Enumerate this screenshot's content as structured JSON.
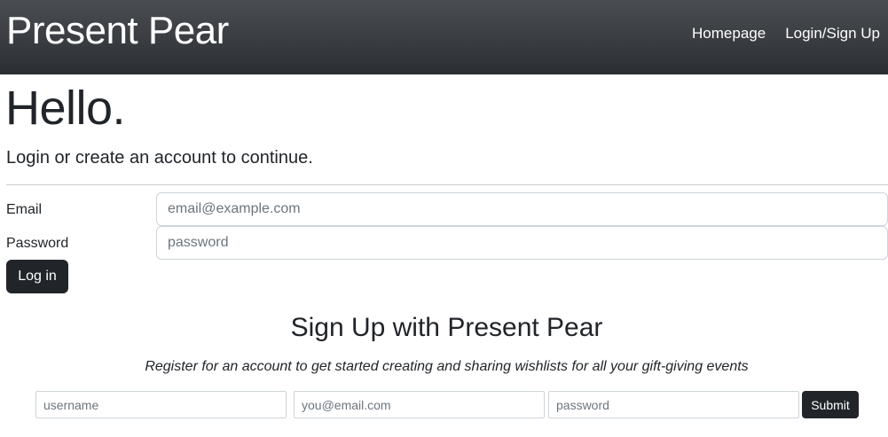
{
  "navbar": {
    "brand": "Present Pear",
    "links": [
      {
        "label": "Homepage"
      },
      {
        "label": "Login/Sign Up"
      }
    ]
  },
  "hero": {
    "title": "Hello.",
    "subtitle": "Login or create an account to continue."
  },
  "login_form": {
    "email_label": "Email",
    "email_placeholder": "email@example.com",
    "password_label": "Password",
    "password_placeholder": "password",
    "submit_label": "Log in"
  },
  "signup": {
    "title": "Sign Up with Present Pear",
    "subtitle": "Register for an account to get started creating and sharing wishlists for all your gift-giving events",
    "username_placeholder": "username",
    "email_placeholder": "you@email.com",
    "password_placeholder": "password",
    "submit_label": "Submit"
  },
  "colors": {
    "navbar_bg": "#343a40",
    "button_bg": "#212529",
    "text": "#212529"
  }
}
